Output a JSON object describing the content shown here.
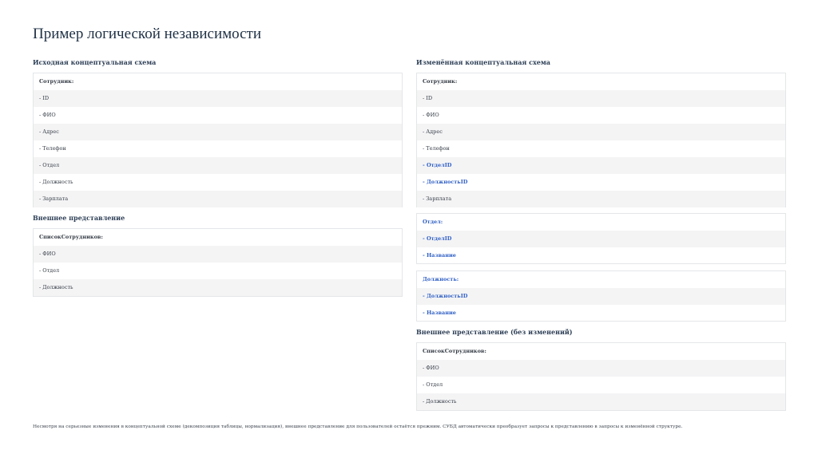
{
  "page_title": "Пример логической независимости",
  "left": {
    "original_heading": "Исходная концептуальная схема",
    "employee": {
      "header": "Сотрудник:",
      "fields": [
        "- ID",
        "- ФИО",
        "- Адрес",
        "- Телефон",
        "- Отдел",
        "- Должность",
        "- Зарплата"
      ]
    },
    "external_heading": "Внешнее представление",
    "external": {
      "header": "СписокСотрудников:",
      "fields": [
        "- ФИО",
        "- Отдел",
        "- Должность"
      ]
    }
  },
  "right": {
    "changed_heading": "Изменённая концептуальная схема",
    "employee": {
      "header": "Сотрудник:",
      "fields": [
        "- ID",
        "- ФИО",
        "- Адрес",
        "- Телефон",
        "- ОтделID",
        "- ДолжностьID",
        "- Зарплата"
      ]
    },
    "department": {
      "header": "Отдел:",
      "fields": [
        "- ОтделID",
        "- Название"
      ]
    },
    "position": {
      "header": "Должность:",
      "fields": [
        "- ДолжностьID",
        "- Название"
      ]
    },
    "external_heading": "Внешнее представление (без изменений)",
    "external": {
      "header": "СписокСотрудников:",
      "fields": [
        "- ФИО",
        "- Отдел",
        "- Должность"
      ]
    }
  },
  "footnote": "Несмотря на серьезные изменения в концептуальной схеме (декомпозиция таблицы, нормализация), внешнее представление для пользователей остаётся прежним. СУБД автоматически преобразует запросы к представлению в запросы к изменённой структуре.",
  "colors": {
    "highlight": "#2f5fc4",
    "row_alt": "#f4f4f5",
    "border": "#e4e6e9"
  }
}
